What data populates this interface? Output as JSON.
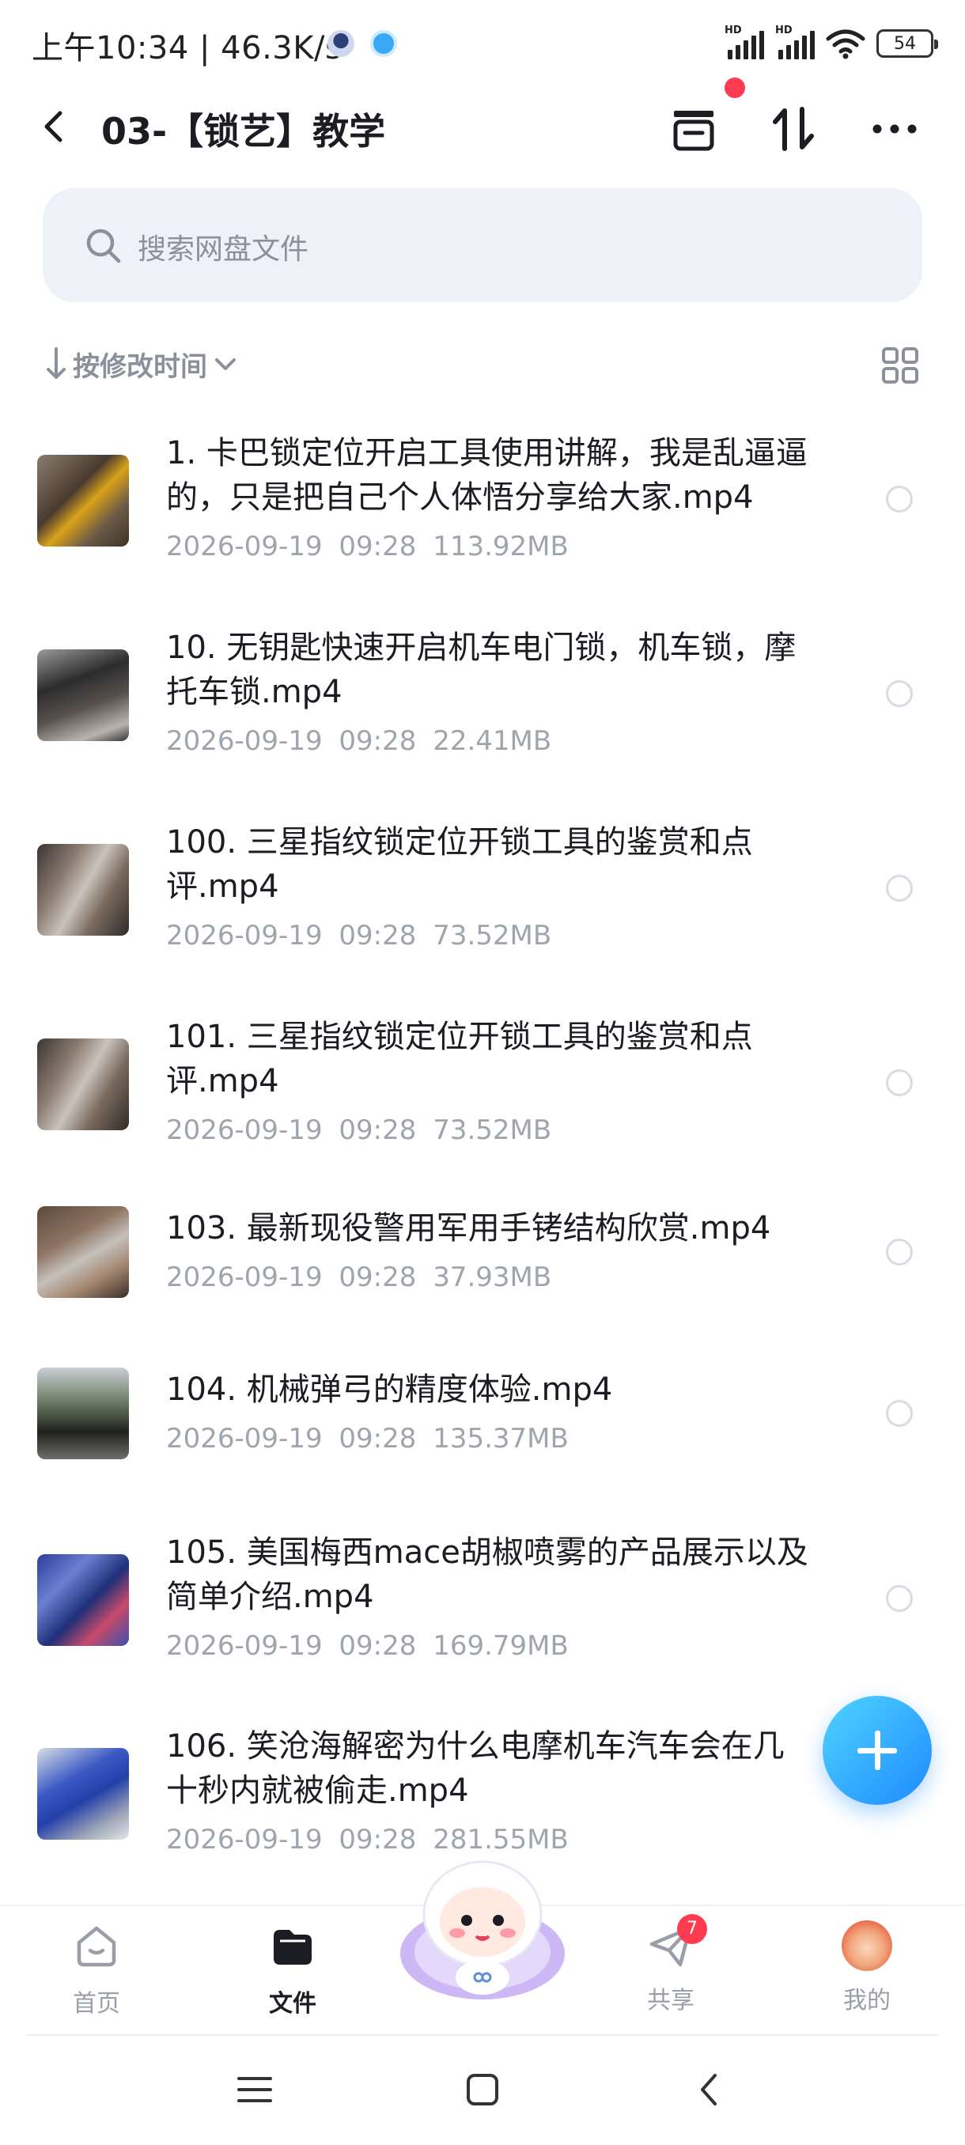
{
  "status_bar": {
    "time": "上午10:34 | 46.3K/s",
    "signal_label_1": "HD",
    "signal_label_2": "HD",
    "battery": "54"
  },
  "header": {
    "title": "03-【锁艺】教学"
  },
  "search": {
    "placeholder": "搜索网盘文件"
  },
  "sort": {
    "label": "按修改时间"
  },
  "files": [
    {
      "name_line1": "1. 卡巴锁定位开启工具使用讲解，我是乱逼逼",
      "name_line2": "的，只是把自己个人体悟分享给大家.mp4",
      "date": "2026-09-19",
      "time": "09:28",
      "size": "113.92MB"
    },
    {
      "name_line1": "10. 无钥匙快速开启机车电门锁，机车锁，摩",
      "name_line2": "托车锁.mp4",
      "date": "2026-09-19",
      "time": "09:28",
      "size": "22.41MB"
    },
    {
      "name_line1": "100. 三星指纹锁定位开锁工具的鉴赏和点",
      "name_line2": "评.mp4",
      "date": "2026-09-19",
      "time": "09:28",
      "size": "73.52MB"
    },
    {
      "name_line1": "101. 三星指纹锁定位开锁工具的鉴赏和点",
      "name_line2": "评.mp4",
      "date": "2026-09-19",
      "time": "09:28",
      "size": "73.52MB"
    },
    {
      "name_line1": "103. 最新现役警用军用手铐结构欣赏.mp4",
      "name_line2": "",
      "date": "2026-09-19",
      "time": "09:28",
      "size": "37.93MB"
    },
    {
      "name_line1": "104. 机械弹弓的精度体验.mp4",
      "name_line2": "",
      "date": "2026-09-19",
      "time": "09:28",
      "size": "135.37MB"
    },
    {
      "name_line1": "105. 美国梅西mace胡椒喷雾的产品展示以及",
      "name_line2": "简单介绍.mp4",
      "date": "2026-09-19",
      "time": "09:28",
      "size": "169.79MB"
    },
    {
      "name_line1": "106. 笑沧海解密为什么电摩机车汽车会在几",
      "name_line2": "十秒内就被偷走.mp4",
      "date": "2026-09-19",
      "time": "09:28",
      "size": "281.55MB"
    }
  ],
  "nav": {
    "home": "首页",
    "files": "文件",
    "share": "共享",
    "share_badge": "7",
    "mine": "我的"
  },
  "colors": {
    "accent": "#1e8bff",
    "badge": "#ff3b52",
    "search_bg": "#eef1f8"
  }
}
